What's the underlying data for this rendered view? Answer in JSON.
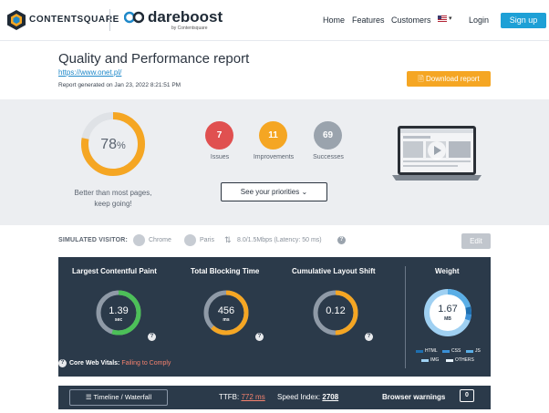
{
  "header": {
    "brand1": "CONTENTSQUARE",
    "brand2": "dareboost",
    "brand2_sub": "by Contentsquare",
    "nav": [
      "Home",
      "Features",
      "Customers"
    ],
    "login": "Login",
    "signup": "Sign up"
  },
  "report": {
    "title": "Quality and Performance report",
    "url": "https://www.onet.pl/",
    "generated": "Report generated on Jan 23, 2022 8:21:51 PM",
    "download": "Download report"
  },
  "summary": {
    "score": 78,
    "score_unit": "%",
    "score_text_1": "Better than most pages,",
    "score_text_2": "keep going!",
    "issues": {
      "count": "7",
      "label": "Issues",
      "color": "#e05050"
    },
    "improvements": {
      "count": "11",
      "label": "Improvements",
      "color": "#f5a623"
    },
    "successes": {
      "count": "69",
      "label": "Successes",
      "color": "#9aa3ad"
    },
    "priorities": "See your priorities"
  },
  "visitor": {
    "label": "SIMULATED VISITOR:",
    "browser": "Chrome",
    "location": "Paris",
    "connection": "8.0/1.5Mbps (Latency: 50 ms)",
    "edit": "Edit"
  },
  "metrics": {
    "lcp": {
      "title": "Largest Contentful Paint",
      "value": "1.39",
      "unit": "sec",
      "level": 0.55,
      "color": "#4cc058"
    },
    "tbt": {
      "title": "Total Blocking Time",
      "value": "456",
      "unit": "ms",
      "level": 0.62,
      "color": "#f5a623"
    },
    "cls": {
      "title": "Cumulative Layout Shift",
      "value": "0.12",
      "unit": "",
      "level": 0.5,
      "color": "#f5a623"
    },
    "cwv_label": "Core Web Vitals:",
    "cwv_status": "Failing to Comply"
  },
  "weight": {
    "title": "Weight",
    "value": "1.67",
    "unit": "MB",
    "legend": [
      "HTML",
      "CSS",
      "JS",
      "IMG",
      "OTHERS"
    ],
    "colors": {
      "HTML": "#1e6fb0",
      "CSS": "#3a8fd6",
      "JS": "#5aaee6",
      "IMG": "#9fd0f2",
      "OTHERS": "#e6f2fb"
    }
  },
  "bottom": {
    "timeline": "Timeline / Waterfall",
    "ttfb_label": "TTFB:",
    "ttfb_value": "772 ms",
    "si_label": "Speed Index:",
    "si_value": "2708",
    "bw_label": "Browser warnings",
    "bw_count": "0"
  }
}
